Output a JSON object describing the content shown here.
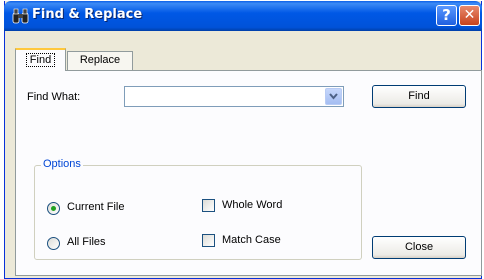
{
  "window": {
    "title": "Find & Replace",
    "help_glyph": "?",
    "close_glyph": "✕"
  },
  "tabs": [
    {
      "label": "Find",
      "active": true
    },
    {
      "label": "Replace",
      "active": false
    }
  ],
  "find": {
    "label": "Find What:",
    "value": "",
    "find_button": "Find",
    "close_button": "Close"
  },
  "options": {
    "legend": "Options",
    "current_file": {
      "label": "Current File",
      "selected": true
    },
    "all_files": {
      "label": "All Files",
      "selected": false
    },
    "whole_word": {
      "label": "Whole Word",
      "checked": false
    },
    "match_case": {
      "label": "Match Case",
      "checked": false
    }
  },
  "icons": {
    "title": "binoculars-icon",
    "combo_arrow": "chevron-down-icon"
  },
  "colors": {
    "title_bar": "#0054e3",
    "accent_legend": "#0046d5",
    "radio_selected": "#21a121",
    "tab_highlight": "#ffc83c"
  }
}
